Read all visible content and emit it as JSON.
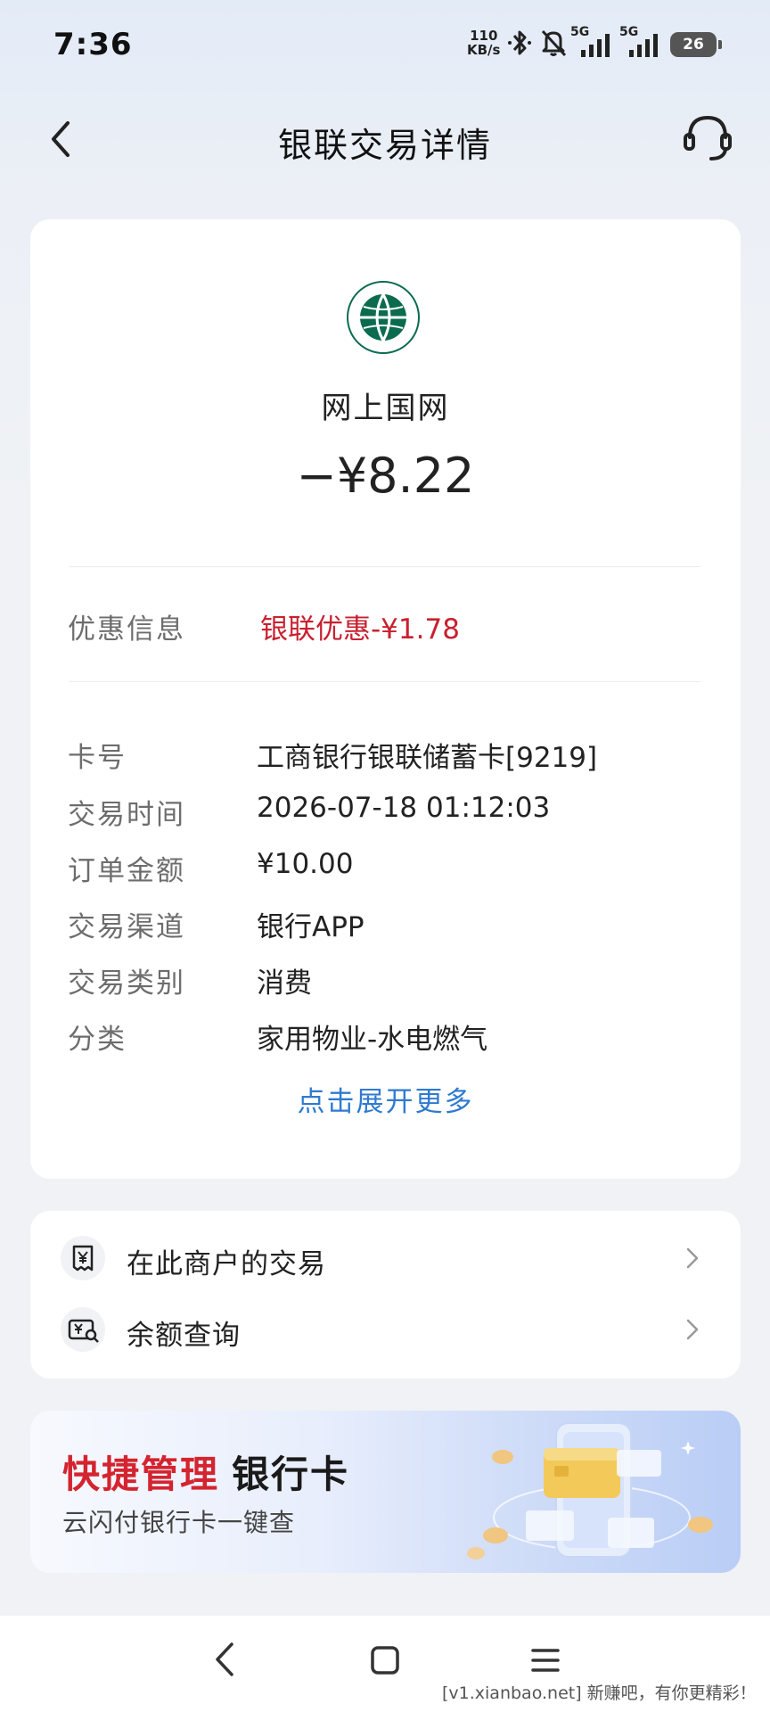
{
  "status_bar": {
    "time": "7:36",
    "speed_value": "110",
    "speed_unit": "KB/s",
    "network_1": "5G",
    "network_2": "5G",
    "battery": "26",
    "icons": [
      "bluetooth-icon",
      "mute-icon",
      "signal-icon",
      "signal-icon"
    ]
  },
  "header": {
    "title": "银联交易详情",
    "back_icon": "chevron-left-icon",
    "service_icon": "headset-icon"
  },
  "transaction": {
    "merchant_name": "网上国网",
    "amount": "−¥8.22",
    "promo_label": "优惠信息",
    "promo_value": "银联优惠-¥1.78",
    "details": [
      {
        "label": "卡号",
        "value": "工商银行银联储蓄卡[9219]"
      },
      {
        "label": "交易时间",
        "value": "2026-07-18 01:12:03"
      },
      {
        "label": "订单金额",
        "value": "¥10.00"
      },
      {
        "label": "交易渠道",
        "value": "银行APP"
      },
      {
        "label": "交易类别",
        "value": "消费"
      },
      {
        "label": "分类",
        "value": "家用物业-水电燃气"
      }
    ],
    "expand_link": "点击展开更多"
  },
  "links": [
    {
      "label": "在此商户的交易",
      "icon": "receipt-icon"
    },
    {
      "label": "余额查询",
      "icon": "balance-query-icon"
    }
  ],
  "banner": {
    "title_red": "快捷管理",
    "title_dark": "银行卡",
    "subtitle": "云闪付银行卡一键查"
  },
  "nav": {
    "icons": [
      "back-icon",
      "home-icon",
      "menu-icon"
    ]
  },
  "watermark": "[v1.xianbao.net] 新赚吧，有你更精彩！",
  "colors": {
    "promo_red": "#c8202f",
    "link_blue": "#2f7ad0",
    "logo_green": "#0b6b4f"
  }
}
